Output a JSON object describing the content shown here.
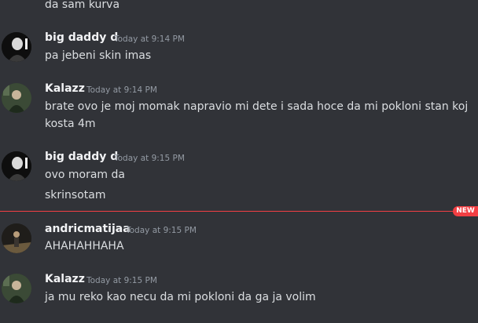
{
  "messages": [
    {
      "lines": [
        "da sam kurva"
      ]
    },
    {
      "author": "big daddy d",
      "timestamp": "Today at 9:14 PM",
      "lines": [
        "pa jebeni skin imas"
      ]
    },
    {
      "author": "Kalazz",
      "timestamp": "Today at 9:14 PM",
      "lines": [
        "brate ovo je moj momak napravio mi dete i sada hoce da mi pokloni stan koj",
        "kosta 4m"
      ]
    },
    {
      "author": "big daddy d",
      "timestamp": "Today at 9:15 PM",
      "lines": [
        "ovo moram da",
        "skrinsotam"
      ]
    },
    {
      "author": "andricmatijaa",
      "timestamp": "Today at 9:15 PM",
      "lines": [
        "AHAHAHHAHA"
      ]
    },
    {
      "author": "Kalazz",
      "timestamp": "Today at 9:15 PM",
      "lines": [
        "ja mu reko kao necu da mi pokloni da ga ja volim"
      ]
    }
  ],
  "new_badge": "NEW"
}
